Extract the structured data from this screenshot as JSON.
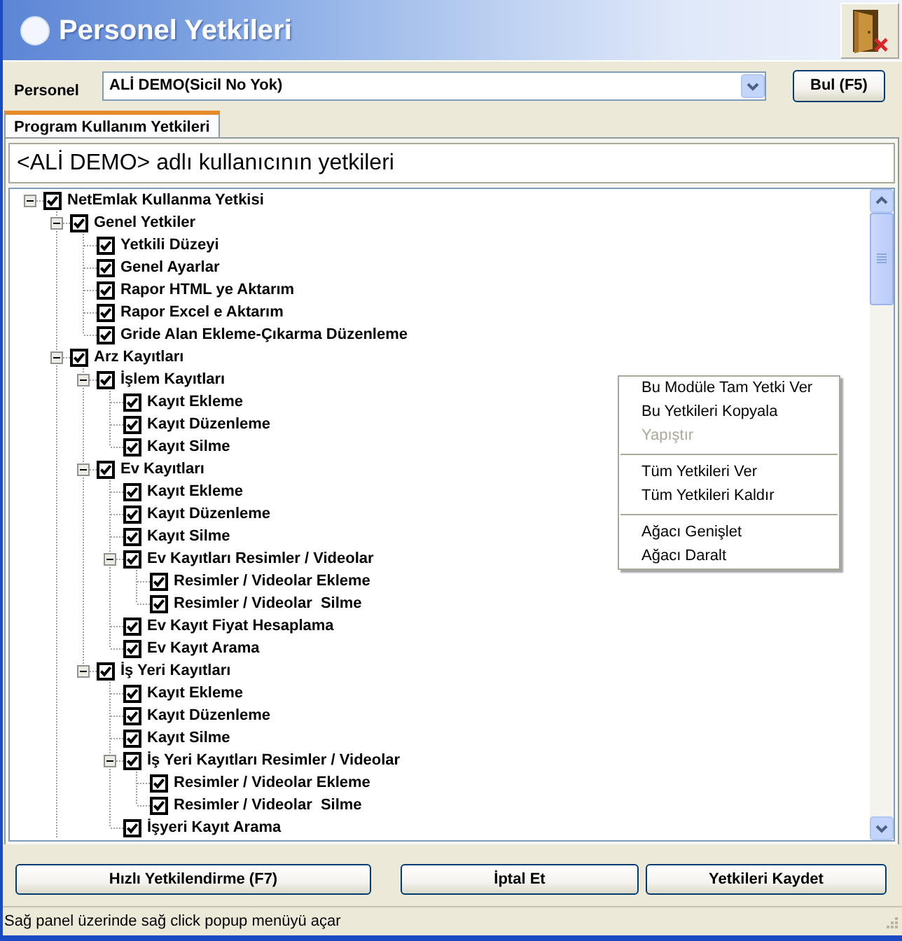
{
  "window": {
    "title": "Personel Yetkileri"
  },
  "personel": {
    "label": "Personel",
    "value": "ALİ DEMO(Sicil No Yok)",
    "button": "Bul (F5)"
  },
  "tabs": [
    {
      "label": "Program Kullanım Yetkileri",
      "selected": true
    }
  ],
  "heading": "<ALİ DEMO> adlı kullanıcının yetkileri",
  "tree": [
    {
      "label": "NetEmlak Kullanma Yetkisi",
      "checked": true,
      "expanded": true,
      "children": [
        {
          "label": "Genel Yetkiler",
          "checked": true,
          "expanded": true,
          "children": [
            {
              "label": "Yetkili Düzeyi",
              "checked": true
            },
            {
              "label": "Genel Ayarlar",
              "checked": true
            },
            {
              "label": "Rapor HTML ye Aktarım",
              "checked": true
            },
            {
              "label": "Rapor Excel e Aktarım",
              "checked": true
            },
            {
              "label": "Gride Alan Ekleme-Çıkarma Düzenleme",
              "checked": true
            }
          ]
        },
        {
          "label": "Arz Kayıtları",
          "checked": true,
          "expanded": true,
          "has_more_below": true,
          "children": [
            {
              "label": "İşlem Kayıtları",
              "checked": true,
              "expanded": true,
              "children": [
                {
                  "label": "Kayıt Ekleme",
                  "checked": true
                },
                {
                  "label": "Kayıt Düzenleme",
                  "checked": true
                },
                {
                  "label": "Kayıt Silme",
                  "checked": true
                }
              ]
            },
            {
              "label": "Ev Kayıtları",
              "checked": true,
              "expanded": true,
              "children": [
                {
                  "label": "Kayıt Ekleme",
                  "checked": true
                },
                {
                  "label": "Kayıt Düzenleme",
                  "checked": true
                },
                {
                  "label": "Kayıt Silme",
                  "checked": true
                },
                {
                  "label": "Ev Kayıtları Resimler / Videolar",
                  "checked": true,
                  "expanded": true,
                  "children": [
                    {
                      "label": "Resimler / Videolar Ekleme",
                      "checked": true
                    },
                    {
                      "label": "Resimler / Videolar  Silme",
                      "checked": true
                    }
                  ]
                },
                {
                  "label": "Ev Kayıt Fiyat Hesaplama",
                  "checked": true
                },
                {
                  "label": "Ev Kayıt Arama",
                  "checked": true
                }
              ]
            },
            {
              "label": "İş Yeri Kayıtları",
              "checked": true,
              "expanded": true,
              "children": [
                {
                  "label": "Kayıt Ekleme",
                  "checked": true
                },
                {
                  "label": "Kayıt Düzenleme",
                  "checked": true
                },
                {
                  "label": "Kayıt Silme",
                  "checked": true
                },
                {
                  "label": "İş Yeri Kayıtları Resimler / Videolar",
                  "checked": true,
                  "expanded": true,
                  "children": [
                    {
                      "label": "Resimler / Videolar Ekleme",
                      "checked": true
                    },
                    {
                      "label": "Resimler / Videolar  Silme",
                      "checked": true
                    }
                  ]
                },
                {
                  "label": "İşyeri Kayıt Arama",
                  "checked": true
                }
              ]
            }
          ]
        }
      ]
    }
  ],
  "context_menu": {
    "groups": [
      [
        {
          "label": "Bu Modüle Tam Yetki Ver",
          "disabled": false
        },
        {
          "label": "Bu Yetkileri Kopyala",
          "disabled": false
        },
        {
          "label": "Yapıştır",
          "disabled": true
        }
      ],
      [
        {
          "label": "Tüm Yetkileri Ver",
          "disabled": false
        },
        {
          "label": "Tüm Yetkileri Kaldır",
          "disabled": false
        }
      ],
      [
        {
          "label": "Ağacı Genişlet",
          "disabled": false
        },
        {
          "label": "Ağacı Daralt",
          "disabled": false
        }
      ]
    ]
  },
  "buttons": [
    "Hızlı Yetkilendirme (F7)",
    "İptal Et",
    "Yetkileri Kaydet"
  ],
  "status_bar": "Sağ panel üzerinde sağ click popup menüyü açar"
}
